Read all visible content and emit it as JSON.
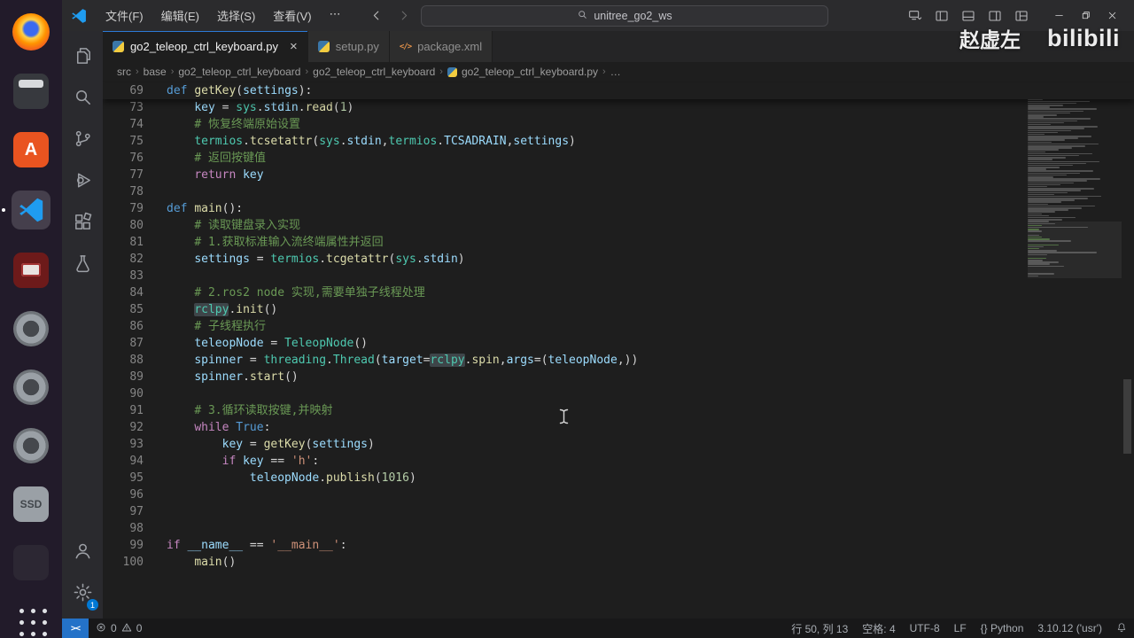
{
  "colors": {
    "accent": "#0078d4",
    "editor_bg": "#1e1e1e",
    "titlebar_bg": "#2b2b2d",
    "dock_bg": "#221b2a",
    "remote_indicator_bg": "#2472c8",
    "comment": "#6a9955",
    "keyword": "#569cd6",
    "control": "#c586c0",
    "function": "#dcdcaa",
    "variable": "#9cdcfe",
    "module": "#4ec9b0",
    "string": "#ce9178",
    "number": "#b5cea8"
  },
  "dock": {
    "items": [
      {
        "name": "firefox",
        "kind": "firefox"
      },
      {
        "name": "files-app",
        "kind": "files"
      },
      {
        "name": "app-a",
        "kind": "appa",
        "glyph": "A"
      },
      {
        "name": "vscode",
        "kind": "vscode",
        "active": true
      },
      {
        "name": "media-app",
        "kind": "redapp"
      },
      {
        "name": "app-placeholder-1",
        "kind": "lens"
      },
      {
        "name": "app-placeholder-2",
        "kind": "lens"
      },
      {
        "name": "app-placeholder-3",
        "kind": "lens"
      },
      {
        "name": "ssd-disk",
        "kind": "ssd",
        "glyph": "SSD"
      },
      {
        "name": "app-placeholder-4",
        "kind": "dim"
      },
      {
        "name": "show-applications",
        "kind": "grid"
      }
    ]
  },
  "titlebar": {
    "menus": [
      "文件(F)",
      "编辑(E)",
      "选择(S)",
      "查看(V)",
      "⋯"
    ],
    "search_text": "unitree_go2_ws",
    "right_icons": [
      "display-dropdown",
      "toggle-sidebar",
      "toggle-panel",
      "toggle-secondary-sidebar",
      "customize-layout"
    ],
    "window_controls": [
      "minimize",
      "restore",
      "close"
    ]
  },
  "activity_bar": {
    "top": [
      "explorer",
      "search",
      "source-control",
      "run-debug",
      "extensions",
      "testing"
    ],
    "bottom": [
      {
        "name": "account"
      },
      {
        "name": "settings",
        "badge": "1"
      }
    ]
  },
  "tabs": [
    {
      "label": "go2_teleop_ctrl_keyboard.py",
      "icon": "python",
      "active": true,
      "close_glyph": "×"
    },
    {
      "label": "setup.py",
      "icon": "python",
      "active": false
    },
    {
      "label": "package.xml",
      "icon": "xml",
      "active": false
    }
  ],
  "breadcrumbs": {
    "items": [
      {
        "label": "src"
      },
      {
        "label": "base"
      },
      {
        "label": "go2_teleop_ctrl_keyboard"
      },
      {
        "label": "go2_teleop_ctrl_keyboard"
      },
      {
        "label": "go2_teleop_ctrl_keyboard.py",
        "icon": "python"
      },
      {
        "label": "…"
      }
    ],
    "separator": "›"
  },
  "watermark": {
    "username": "赵虚左",
    "brand": "bilibili"
  },
  "editor": {
    "total_lines": 100,
    "sticky": {
      "n": 69,
      "g": [
        [
          "k",
          "def"
        ],
        [
          "o",
          " "
        ],
        [
          "f",
          "getKey"
        ],
        [
          "o",
          "("
        ],
        [
          "v",
          "settings"
        ],
        [
          "o",
          "):"
        ]
      ]
    },
    "lines": [
      {
        "n": 73,
        "g": [
          [
            "o",
            "    "
          ],
          [
            "v",
            "key"
          ],
          [
            "o",
            " = "
          ],
          [
            "m",
            "sys"
          ],
          [
            "o",
            "."
          ],
          [
            "v",
            "stdin"
          ],
          [
            "o",
            "."
          ],
          [
            "f",
            "read"
          ],
          [
            "o",
            "("
          ],
          [
            "n",
            "1"
          ],
          [
            "o",
            ")"
          ]
        ]
      },
      {
        "n": 74,
        "g": [
          [
            "o",
            "    "
          ],
          [
            "c",
            "# 恢复终端原始设置"
          ]
        ]
      },
      {
        "n": 75,
        "g": [
          [
            "o",
            "    "
          ],
          [
            "m",
            "termios"
          ],
          [
            "o",
            "."
          ],
          [
            "f",
            "tcsetattr"
          ],
          [
            "o",
            "("
          ],
          [
            "m",
            "sys"
          ],
          [
            "o",
            "."
          ],
          [
            "v",
            "stdin"
          ],
          [
            "o",
            ","
          ],
          [
            "m",
            "termios"
          ],
          [
            "o",
            "."
          ],
          [
            "v",
            "TCSADRAIN"
          ],
          [
            "o",
            ","
          ],
          [
            "v",
            "settings"
          ],
          [
            "o",
            ")"
          ]
        ]
      },
      {
        "n": 76,
        "g": [
          [
            "o",
            "    "
          ],
          [
            "c",
            "# 返回按键值"
          ]
        ]
      },
      {
        "n": 77,
        "g": [
          [
            "o",
            "    "
          ],
          [
            "cf",
            "return"
          ],
          [
            "o",
            " "
          ],
          [
            "v",
            "key"
          ]
        ]
      },
      {
        "n": 78,
        "g": []
      },
      {
        "n": 79,
        "g": [
          [
            "k",
            "def"
          ],
          [
            "o",
            " "
          ],
          [
            "f",
            "main"
          ],
          [
            "o",
            "():"
          ]
        ]
      },
      {
        "n": 80,
        "g": [
          [
            "o",
            "    "
          ],
          [
            "c",
            "# 读取键盘录入实现"
          ]
        ]
      },
      {
        "n": 81,
        "g": [
          [
            "o",
            "    "
          ],
          [
            "c",
            "# 1.获取标准输入流终端属性并返回"
          ]
        ]
      },
      {
        "n": 82,
        "g": [
          [
            "o",
            "    "
          ],
          [
            "v",
            "settings"
          ],
          [
            "o",
            " = "
          ],
          [
            "m",
            "termios"
          ],
          [
            "o",
            "."
          ],
          [
            "f",
            "tcgetattr"
          ],
          [
            "o",
            "("
          ],
          [
            "m",
            "sys"
          ],
          [
            "o",
            "."
          ],
          [
            "v",
            "stdin"
          ],
          [
            "o",
            ")"
          ]
        ]
      },
      {
        "n": 83,
        "g": []
      },
      {
        "n": 84,
        "g": [
          [
            "o",
            "    "
          ],
          [
            "c",
            "# 2.ros2 node 实现,需要单独子线程处理"
          ]
        ]
      },
      {
        "n": 85,
        "g": [
          [
            "o",
            "    "
          ],
          [
            "m",
            "rclpy",
            1
          ],
          [
            "o",
            "."
          ],
          [
            "f",
            "init"
          ],
          [
            "o",
            "()"
          ]
        ]
      },
      {
        "n": 86,
        "g": [
          [
            "o",
            "    "
          ],
          [
            "c",
            "# 子线程执行"
          ]
        ]
      },
      {
        "n": 87,
        "g": [
          [
            "o",
            "    "
          ],
          [
            "v",
            "teleopNode"
          ],
          [
            "o",
            " = "
          ],
          [
            "m",
            "TeleopNode"
          ],
          [
            "o",
            "()"
          ]
        ]
      },
      {
        "n": 88,
        "g": [
          [
            "o",
            "    "
          ],
          [
            "v",
            "spinner"
          ],
          [
            "o",
            " = "
          ],
          [
            "m",
            "threading"
          ],
          [
            "o",
            "."
          ],
          [
            "m",
            "Thread"
          ],
          [
            "o",
            "("
          ],
          [
            "v",
            "target"
          ],
          [
            "o",
            "="
          ],
          [
            "m",
            "rclpy",
            1
          ],
          [
            "o",
            "."
          ],
          [
            "f",
            "spin"
          ],
          [
            "o",
            ","
          ],
          [
            "v",
            "args"
          ],
          [
            "o",
            "=("
          ],
          [
            "v",
            "teleopNode"
          ],
          [
            "o",
            ",))"
          ]
        ]
      },
      {
        "n": 89,
        "g": [
          [
            "o",
            "    "
          ],
          [
            "v",
            "spinner"
          ],
          [
            "o",
            "."
          ],
          [
            "f",
            "start"
          ],
          [
            "o",
            "()"
          ]
        ]
      },
      {
        "n": 90,
        "g": []
      },
      {
        "n": 91,
        "g": [
          [
            "o",
            "    "
          ],
          [
            "c",
            "# 3.循环读取按键,并映射"
          ]
        ]
      },
      {
        "n": 92,
        "g": [
          [
            "o",
            "    "
          ],
          [
            "cf",
            "while"
          ],
          [
            "o",
            " "
          ],
          [
            "k",
            "True"
          ],
          [
            "o",
            ":"
          ]
        ]
      },
      {
        "n": 93,
        "g": [
          [
            "o",
            "        "
          ],
          [
            "v",
            "key"
          ],
          [
            "o",
            " = "
          ],
          [
            "f",
            "getKey"
          ],
          [
            "o",
            "("
          ],
          [
            "v",
            "settings"
          ],
          [
            "o",
            ")"
          ]
        ]
      },
      {
        "n": 94,
        "g": [
          [
            "o",
            "        "
          ],
          [
            "cf",
            "if"
          ],
          [
            "o",
            " "
          ],
          [
            "v",
            "key"
          ],
          [
            "o",
            " == "
          ],
          [
            "s",
            "'h'"
          ],
          [
            "o",
            ":"
          ]
        ]
      },
      {
        "n": 95,
        "g": [
          [
            "o",
            "            "
          ],
          [
            "v",
            "teleopNode"
          ],
          [
            "o",
            "."
          ],
          [
            "f",
            "publish"
          ],
          [
            "o",
            "("
          ],
          [
            "n",
            "1016"
          ],
          [
            "o",
            ")"
          ]
        ]
      },
      {
        "n": 96,
        "g": []
      },
      {
        "n": 97,
        "g": []
      },
      {
        "n": 98,
        "g": []
      },
      {
        "n": 99,
        "g": [
          [
            "cf",
            "if"
          ],
          [
            "o",
            " "
          ],
          [
            "v",
            "__name__"
          ],
          [
            "o",
            " == "
          ],
          [
            "s",
            "'__main__'"
          ],
          [
            "o",
            ":"
          ]
        ]
      },
      {
        "n": 100,
        "g": [
          [
            "o",
            "    "
          ],
          [
            "f",
            "main"
          ],
          [
            "o",
            "()"
          ]
        ]
      }
    ]
  },
  "status_bar": {
    "remote_glyph": "><",
    "errors": "0",
    "warnings": "0",
    "right": [
      {
        "name": "cursor-position",
        "text": "行 50, 列 13"
      },
      {
        "name": "indentation",
        "text": "空格: 4"
      },
      {
        "name": "encoding",
        "text": "UTF-8"
      },
      {
        "name": "eol",
        "text": "LF"
      },
      {
        "name": "language-mode",
        "text": "{} Python"
      },
      {
        "name": "python-interpreter",
        "text": "3.10.12 ('usr')"
      }
    ]
  }
}
